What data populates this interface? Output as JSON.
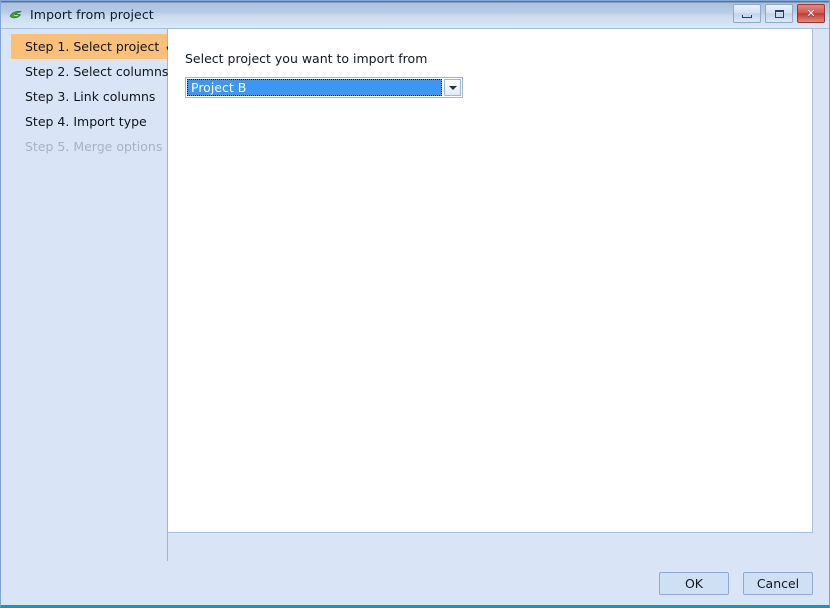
{
  "window": {
    "title": "Import from project",
    "icon": "leaf-swoosh-icon",
    "controls": {
      "minimize": "minimize-icon",
      "maximize": "maximize-icon",
      "close": "✕"
    },
    "accent_color": "#fbc077",
    "titlebar_color": "#b7cbe4",
    "panel_color": "#d9e5f7",
    "bottom_border_color": "#0c9cb5"
  },
  "sidebar": {
    "items": [
      {
        "label": "Step 1. Select project",
        "state": "active",
        "check": "✔"
      },
      {
        "label": "Step 2. Select columns",
        "state": "normal",
        "check": ""
      },
      {
        "label": "Step 3. Link columns",
        "state": "normal",
        "check": ""
      },
      {
        "label": "Step 4. Import type",
        "state": "normal",
        "check": ""
      },
      {
        "label": "Step 5. Merge options",
        "state": "disabled",
        "check": ""
      }
    ]
  },
  "main": {
    "prompt": "Select project you want to import from",
    "combo": {
      "value": "Project B",
      "placeholder": "Project B",
      "selected": true,
      "arrow": "chevron-down-icon",
      "options": [
        "Project B"
      ]
    }
  },
  "footer": {
    "ok_label": "OK",
    "cancel_label": "Cancel"
  }
}
